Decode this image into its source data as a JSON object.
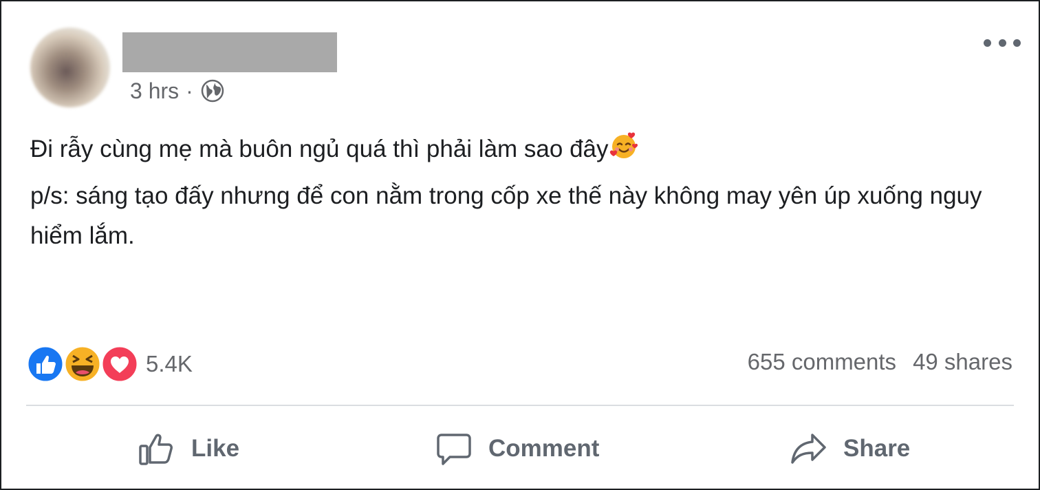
{
  "post": {
    "time": "3 hrs",
    "separator": "·",
    "text": {
      "line1": "Đi rẫy cùng mẹ mà buôn ngủ quá thì phải làm sao đây",
      "line2": "p/s: sáng tạo đấy nhưng để con nằm trong cốp xe thế này không may yên úp xuống nguy hiểm lắm."
    },
    "emoji_icon": "smiling-face-with-hearts-icon"
  },
  "stats": {
    "reaction_icons": [
      "like-reaction-icon",
      "haha-reaction-icon",
      "love-reaction-icon"
    ],
    "reaction_count": "5.4K",
    "comments": "655 comments",
    "shares": "49 shares"
  },
  "actions": {
    "like": "Like",
    "comment": "Comment",
    "share": "Share"
  },
  "colors": {
    "secondary_text": "#65676b",
    "primary_text": "#1c1e21",
    "like_blue": "#1877f2",
    "love_red": "#f33e58",
    "haha_yellow": "#f7b125"
  }
}
